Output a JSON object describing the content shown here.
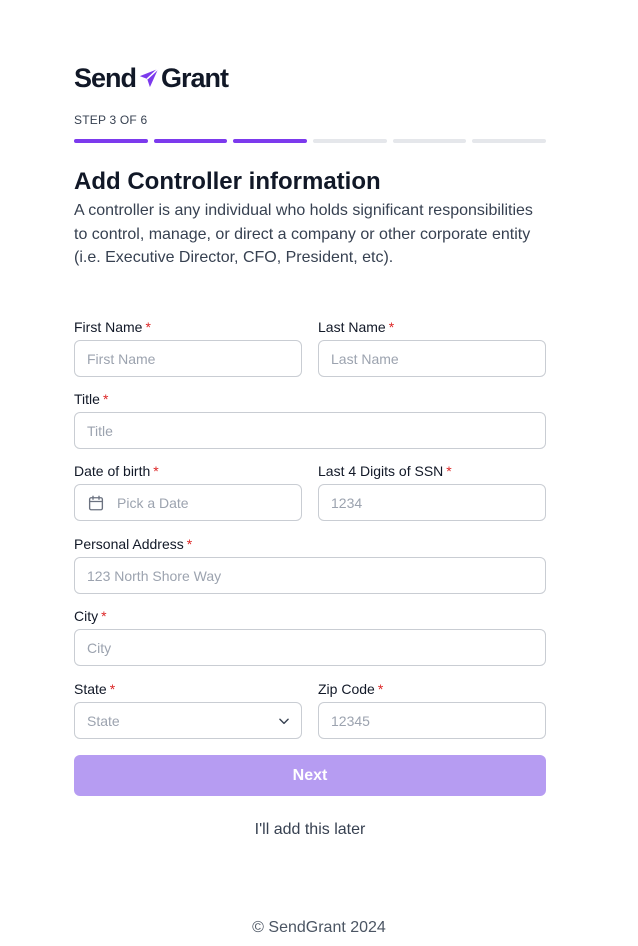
{
  "brand": {
    "name_part1": "Send",
    "name_part2": "Grant",
    "accent_color": "#7c3aed"
  },
  "progress": {
    "step_label": "STEP 3 OF 6",
    "current_step": 3,
    "total_steps": 6
  },
  "form": {
    "title": "Add Controller information",
    "description": "A controller is any individual who holds significant responsibilities to control, manage, or direct a company or other corporate entity (i.e. Executive Director, CFO, President, etc).",
    "required_marker": "*",
    "fields": {
      "first_name": {
        "label": "First Name",
        "placeholder": "First Name"
      },
      "last_name": {
        "label": "Last Name",
        "placeholder": "Last Name"
      },
      "title": {
        "label": "Title",
        "placeholder": "Title"
      },
      "dob": {
        "label": "Date of birth",
        "placeholder": "Pick a Date",
        "icon": "calendar-icon"
      },
      "ssn": {
        "label": "Last 4 Digits of SSN",
        "placeholder": "1234"
      },
      "address": {
        "label": "Personal Address",
        "placeholder": "123 North Shore Way"
      },
      "city": {
        "label": "City",
        "placeholder": "City"
      },
      "state": {
        "label": "State",
        "placeholder": "State",
        "icon": "chevron-down-icon"
      },
      "zip": {
        "label": "Zip Code",
        "placeholder": "12345"
      }
    },
    "next_label": "Next",
    "next_color": "#b69cf2",
    "later_label": "I'll add this later"
  },
  "footer": {
    "copyright": "© SendGrant 2024"
  }
}
